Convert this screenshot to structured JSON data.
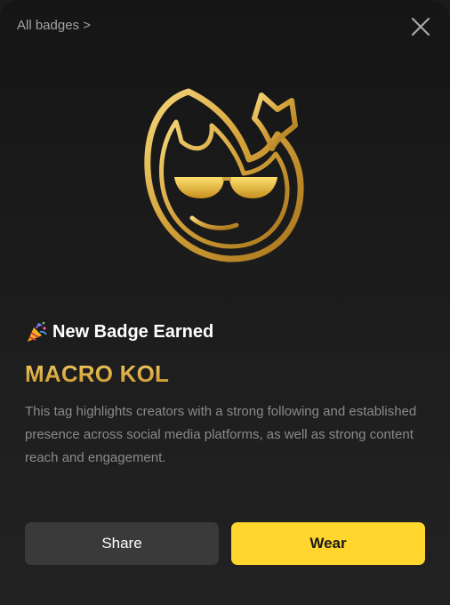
{
  "header": {
    "all_badges_label": "All badges >",
    "close_icon": "close-icon"
  },
  "badge": {
    "icon": "flame-crown-sunglasses-badge",
    "earned_label": "New Badge Earned",
    "earned_icon": "party-popper-icon",
    "name": "MACRO KOL",
    "description": "This tag highlights creators with a strong following and established presence across social media platforms, as well as strong content reach and engagement."
  },
  "actions": {
    "share_label": "Share",
    "wear_label": "Wear"
  },
  "colors": {
    "background": "#1c1c1c",
    "gold": "#d9ac3c",
    "wear_button": "#ffd52e",
    "share_button": "#3a3a3a"
  }
}
